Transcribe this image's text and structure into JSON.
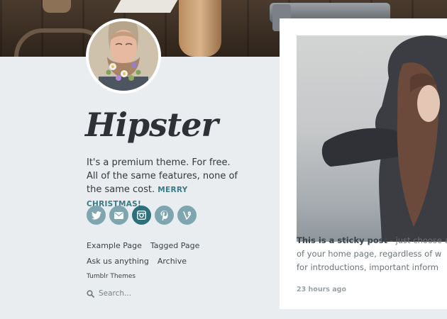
{
  "blog": {
    "title": "Hipster",
    "tagline_main": "It's a premium theme. For free. All of the same features, none of the same cost.",
    "tagline_highlight": "MERRY CHRISTMAS!"
  },
  "social": [
    {
      "icon": "twitter-icon",
      "active": false
    },
    {
      "icon": "mail-icon",
      "active": false
    },
    {
      "icon": "instagram-icon",
      "active": true
    },
    {
      "icon": "pinterest-icon",
      "active": false
    },
    {
      "icon": "vine-icon",
      "active": false
    }
  ],
  "nav": {
    "example_page": "Example Page",
    "tagged_page": "Tagged Page",
    "ask": "Ask us anything",
    "archive": "Archive",
    "tumblr_themes": "Tumblr Themes"
  },
  "search": {
    "placeholder": "Search..."
  },
  "post": {
    "title": "This is a sticky post",
    "line1_rest": " - just choose a",
    "line2": "of your home page, regardless of w",
    "line3": "for introductions, important inform",
    "timestamp": "23 hours ago"
  },
  "colors": {
    "page_background": "#e9edef",
    "accent": "#2d6f7b",
    "social_button": "#7fa5af",
    "highlight_text": "#3b7a86"
  }
}
